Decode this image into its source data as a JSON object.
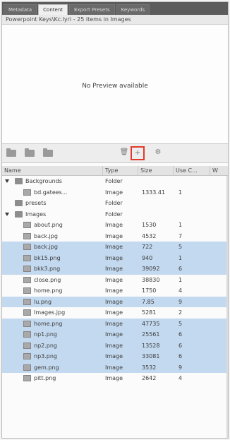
{
  "tabs": [
    {
      "label": "Metadata",
      "active": false
    },
    {
      "label": "Content",
      "active": true
    },
    {
      "label": "Export Presets",
      "active": false
    },
    {
      "label": "Keywords",
      "active": false
    }
  ],
  "preview": {
    "header_text": "Powerpoint Keys\\Kc.lyri - 25 items in Images",
    "message": "No Preview available"
  },
  "toolbar": {
    "buttons": [
      {
        "name": "new-folder-icon",
        "glyph": ""
      },
      {
        "name": "open-folder-icon",
        "glyph": ""
      },
      {
        "name": "move-folder-icon",
        "glyph": ""
      },
      {
        "name": "trash-icon",
        "glyph": "🗑"
      },
      {
        "name": "add-item-icon",
        "glyph": "+"
      },
      {
        "name": "settings-icon",
        "glyph": "⚙"
      }
    ]
  },
  "table": {
    "columns": [
      "Name",
      "Type",
      "Size",
      "Use C...",
      "W"
    ],
    "rows": [
      {
        "name": "Backgrounds",
        "type": "Folder",
        "size": "",
        "uses": "",
        "depth": 0,
        "kind": "folder",
        "expanded": true,
        "selected": false
      },
      {
        "name": "bd.gatees...",
        "type": "Image",
        "size": "1333.41",
        "uses": "1",
        "depth": 1,
        "kind": "image",
        "selected": false
      },
      {
        "name": "presets",
        "type": "Folder",
        "size": "",
        "uses": "",
        "depth": 0,
        "kind": "folder",
        "expanded": false,
        "selected": false
      },
      {
        "name": "Images",
        "type": "Folder",
        "size": "",
        "uses": "",
        "depth": 0,
        "kind": "folder",
        "expanded": true,
        "selected": false
      },
      {
        "name": "about.png",
        "type": "Image",
        "size": "1530",
        "uses": "1",
        "depth": 1,
        "kind": "image",
        "selected": false
      },
      {
        "name": "back.jpg",
        "type": "Image",
        "size": "4532",
        "uses": "7",
        "depth": 1,
        "kind": "image",
        "selected": false
      },
      {
        "name": "back.jpg",
        "type": "Image",
        "size": "722",
        "uses": "5",
        "depth": 1,
        "kind": "image",
        "selected": true
      },
      {
        "name": "bk15.png",
        "type": "Image",
        "size": "940",
        "uses": "1",
        "depth": 1,
        "kind": "image",
        "selected": true
      },
      {
        "name": "bkk3.png",
        "type": "Image",
        "size": "39092",
        "uses": "6",
        "depth": 1,
        "kind": "image",
        "selected": true
      },
      {
        "name": "close.png",
        "type": "Image",
        "size": "38830",
        "uses": "1",
        "depth": 1,
        "kind": "image",
        "selected": false
      },
      {
        "name": "home.png",
        "type": "Image",
        "size": "1750",
        "uses": "4",
        "depth": 1,
        "kind": "image",
        "selected": false
      },
      {
        "name": "lu.png",
        "type": "Image",
        "size": "7.85",
        "uses": "9",
        "depth": 1,
        "kind": "image",
        "selected": true
      },
      {
        "name": "Images.jpg",
        "type": "Image",
        "size": "5281",
        "uses": "2",
        "depth": 1,
        "kind": "image",
        "selected": false
      },
      {
        "name": "home.png",
        "type": "Image",
        "size": "47735",
        "uses": "5",
        "depth": 1,
        "kind": "image",
        "selected": true
      },
      {
        "name": "np1.png",
        "type": "Image",
        "size": "25561",
        "uses": "6",
        "depth": 1,
        "kind": "image",
        "selected": true
      },
      {
        "name": "np2.png",
        "type": "Image",
        "size": "13528",
        "uses": "6",
        "depth": 1,
        "kind": "image",
        "selected": true
      },
      {
        "name": "np3.png",
        "type": "Image",
        "size": "33081",
        "uses": "6",
        "depth": 1,
        "kind": "image",
        "selected": true
      },
      {
        "name": "gem.png",
        "type": "Image",
        "size": "3532",
        "uses": "9",
        "depth": 1,
        "kind": "image",
        "selected": true
      },
      {
        "name": "pitt.png",
        "type": "Image",
        "size": "2642",
        "uses": "4",
        "depth": 1,
        "kind": "image",
        "selected": false
      }
    ]
  },
  "colors": {
    "selection": "#c3d9ef",
    "highlight_border": "#e23a2a",
    "tab_bar": "#5c5c5c"
  }
}
